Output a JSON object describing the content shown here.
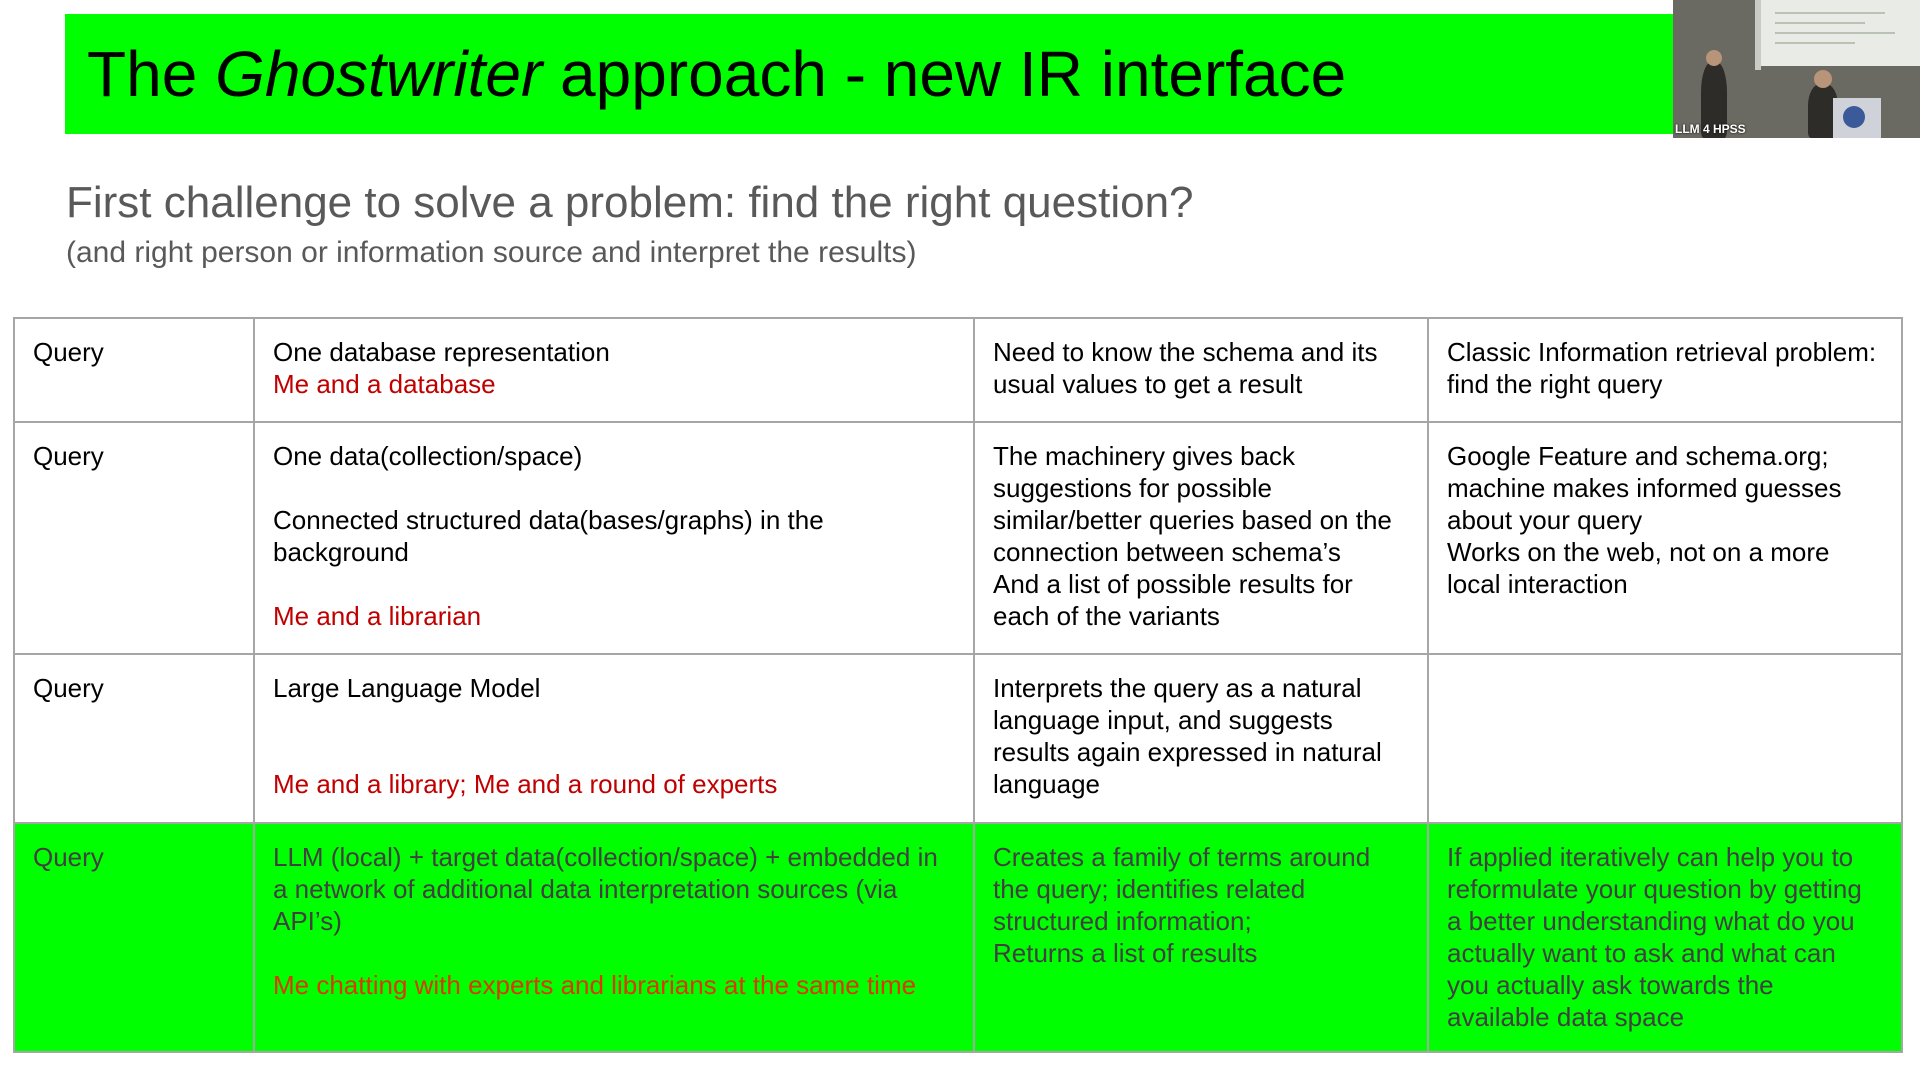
{
  "slide": {
    "title_prefix": "The ",
    "title_italic": "Ghostwriter",
    "title_suffix": " approach - new IR interface",
    "subtitle": "First challenge to solve a problem: find the right question?",
    "subnote": "(and right person or information source and interpret the results)"
  },
  "video": {
    "caption": "LLM 4 HPSS"
  },
  "colors": {
    "highlight": "#00ff00",
    "accent_red": "#c00000",
    "border": "#a6a6a6",
    "subtitle_gray": "#595959"
  },
  "table": {
    "rows": [
      {
        "label": "Query",
        "col2_main": "One database representation",
        "col2_sub": "",
        "col2_red": "Me and a database",
        "col3": "Need to know the schema and its usual values to get a result",
        "col4_lines": [
          "Classic Information retrieval problem: find the right query"
        ]
      },
      {
        "label": "Query",
        "col2_main": "One data(collection/space)",
        "col2_sub": "Connected structured data(bases/graphs) in the background",
        "col2_red": "Me and a librarian",
        "col3_lines": [
          "The machinery gives back suggestions for possible similar/better queries based on the connection between schema’s",
          "And a list of possible results for each of the variants"
        ],
        "col4_lines": [
          "Google Feature and schema.org; machine makes informed guesses about your query",
          "Works on the web, not on a more local interaction"
        ]
      },
      {
        "label": "Query",
        "col2_main": "Large Language Model",
        "col2_red": "Me and a library; Me and a round of experts",
        "col3": "Interprets the query as a natural language input, and suggests results again expressed in natural language",
        "col4": ""
      },
      {
        "label": "Query",
        "col2_main": "LLM (local) + target data(collection/space)  + embedded in a network of additional data interpretation sources (via API’s)",
        "col2_red": "Me chatting with experts and librarians at the same time",
        "col3_lines": [
          "Creates a family of terms around the query; identifies related structured information;",
          "Returns a list of results"
        ],
        "col4": "If applied iteratively can help you to reformulate your question by getting a better understanding what do you actually want to ask and what can you actually ask towards the available data space"
      }
    ]
  }
}
